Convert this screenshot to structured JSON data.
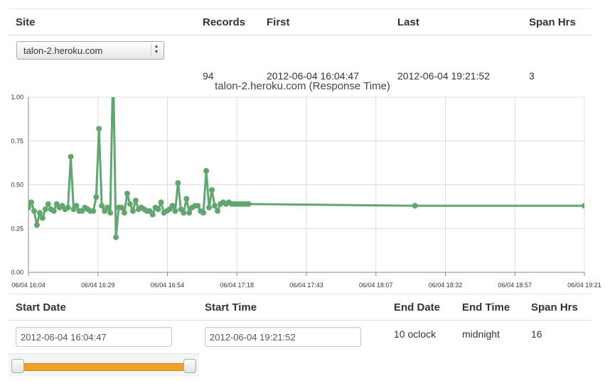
{
  "top_table": {
    "headers": {
      "site": "Site",
      "records": "Records",
      "first": "First",
      "last": "Last",
      "span": "Span Hrs"
    },
    "row": {
      "site_selected": "talon-2.heroku.com",
      "records": "94",
      "first": "2012-06-04 16:04:47",
      "last": "2012-06-04 19:21:52",
      "span": "3"
    }
  },
  "chart_data": {
    "type": "line",
    "title": "talon-2.heroku.com (Response Time)",
    "xlabel": "",
    "ylabel": "",
    "ylim": [
      0,
      1
    ],
    "y_ticks": [
      "0.00",
      "0.25",
      "0.50",
      "0.75",
      "1.00"
    ],
    "x_ticks": [
      "06/04 16:04",
      "06/04 16:29",
      "06/04 16:54",
      "06/04 17:18",
      "06/04 17:43",
      "06/04 18:07",
      "06/04 18:32",
      "06/04 18:57",
      "06/04 19:21"
    ],
    "x_range_minutes": [
      0,
      197
    ],
    "grid": true,
    "line_color": "#5fa66f",
    "series": [
      {
        "x_minutes": [
          0,
          1,
          2,
          3,
          4,
          5,
          6,
          7,
          8,
          9,
          10,
          11,
          12,
          13,
          14,
          15,
          16,
          17,
          18,
          19,
          20,
          21,
          22,
          23,
          24,
          25,
          26,
          27,
          28,
          29,
          30,
          31,
          32,
          33,
          34,
          35,
          36,
          37,
          38,
          39,
          40,
          41,
          42,
          43,
          44,
          45,
          46,
          47,
          48,
          49,
          50,
          51,
          52,
          53,
          54,
          55,
          56,
          57,
          58,
          59,
          60,
          61,
          62,
          63,
          64,
          65,
          66,
          67,
          68,
          69,
          70,
          71,
          72,
          73,
          74,
          75,
          76,
          77,
          78,
          137,
          197
        ],
        "values": [
          0.37,
          0.4,
          0.35,
          0.27,
          0.34,
          0.31,
          0.36,
          0.39,
          0.36,
          0.35,
          0.39,
          0.37,
          0.38,
          0.36,
          0.37,
          0.66,
          0.36,
          0.38,
          0.35,
          0.35,
          0.37,
          0.36,
          0.35,
          0.35,
          0.43,
          0.82,
          0.38,
          0.35,
          0.37,
          0.34,
          1.2,
          0.2,
          0.37,
          0.37,
          0.34,
          0.45,
          0.39,
          0.35,
          0.41,
          0.36,
          0.37,
          0.36,
          0.35,
          0.35,
          0.33,
          0.37,
          0.36,
          0.4,
          0.34,
          0.35,
          0.36,
          0.38,
          0.35,
          0.51,
          0.36,
          0.34,
          0.42,
          0.34,
          0.37,
          0.38,
          0.38,
          0.35,
          0.34,
          0.58,
          0.37,
          0.47,
          0.38,
          0.35,
          0.39,
          0.4,
          0.39,
          0.4,
          0.39,
          0.39,
          0.39,
          0.39,
          0.39,
          0.39,
          0.39,
          0.38,
          0.38
        ]
      }
    ]
  },
  "bottom_table": {
    "headers": {
      "start_date": "Start Date",
      "start_time": "Start Time",
      "end_date": "End Date",
      "end_time": "End Time",
      "span": "Span Hrs"
    },
    "start_date_value": "2012-06-04 16:04:47",
    "start_time_value": "2012-06-04 19:21:52",
    "end_date": "10 oclock",
    "end_time": "midnight",
    "span": "16"
  },
  "slider": {
    "range_fill_color": "#f0a022",
    "low": 0.0,
    "high": 1.0
  }
}
